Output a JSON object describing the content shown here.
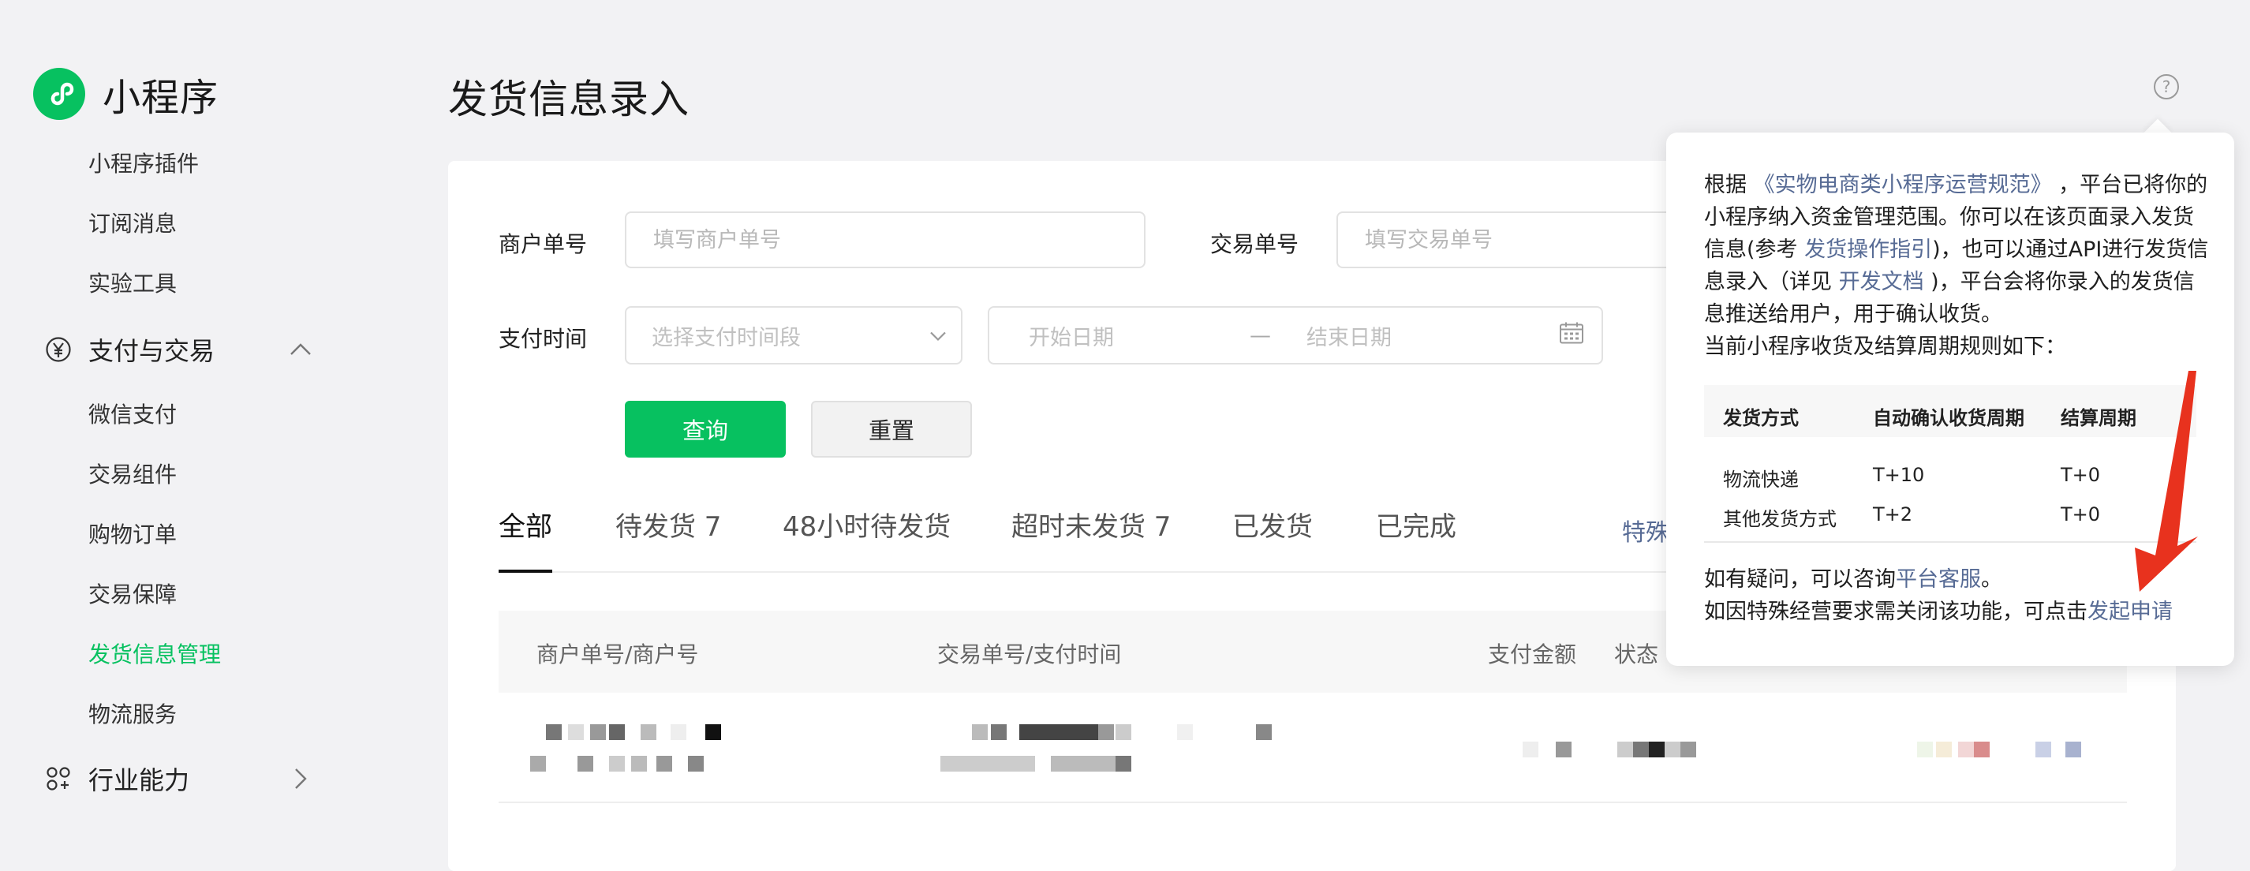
{
  "sidebar": {
    "brand": "小程序",
    "items_top": [
      "小程序插件",
      "订阅消息",
      "实验工具"
    ],
    "group_pay": "支付与交易",
    "items_pay": [
      "微信支付",
      "交易组件",
      "购物订单",
      "交易保障",
      "发货信息管理",
      "物流服务"
    ],
    "group_industry": "行业能力"
  },
  "main": {
    "title": "发货信息录入",
    "help": "?",
    "form": {
      "merchant_label": "商户单号",
      "merchant_placeholder": "填写商户单号",
      "trade_label": "交易单号",
      "trade_placeholder": "填写交易单号",
      "paytime_label": "支付时间",
      "paytime_select": "选择支付时间段",
      "start_date": "开始日期",
      "date_sep": "—",
      "end_date": "结束日期",
      "query_button": "查询",
      "reset_button": "重置"
    },
    "tabs": [
      "全部",
      "待发货 7",
      "48小时待发货",
      "超时未发货 7",
      "已发货",
      "已完成"
    ],
    "special_link": "特殊",
    "table_headers": [
      "商户单号/商户号",
      "交易单号/支付时间",
      "支付金额",
      "状态"
    ]
  },
  "popover": {
    "p1_pre": "根据 ",
    "p1_link1": "《实物电商类小程序运营规范》",
    "p1_mid": " ，平台已将你的小程序纳入资金管理范围。你可以在该页面录入发货信息(参考 ",
    "p1_link2": "发货操作指引",
    "p1_mid2": ")，也可以通过API进行发货信息录入（详见 ",
    "p1_link3": "开发文档",
    "p1_end": " )，平台会将你录入的发货信息推送给用户，用于确认收货。",
    "p2": "当前小程序收货及结算周期规则如下：",
    "table": {
      "headers": [
        "发货方式",
        "自动确认收货周期",
        "结算周期"
      ],
      "rows": [
        [
          "物流快递",
          "T+10",
          "T+0"
        ],
        [
          "其他发货方式",
          "T+2",
          "T+0"
        ]
      ]
    },
    "f1_pre": "如有疑问，可以咨询",
    "f1_link": "平台客服",
    "f1_end": "。",
    "f2_pre": "如因特殊经营要求需关闭该功能，可点击",
    "f2_link": "发起申请"
  },
  "colors": {
    "accent": "#07c160",
    "link": "#576b95",
    "annotation_arrow": "#e8321e"
  }
}
